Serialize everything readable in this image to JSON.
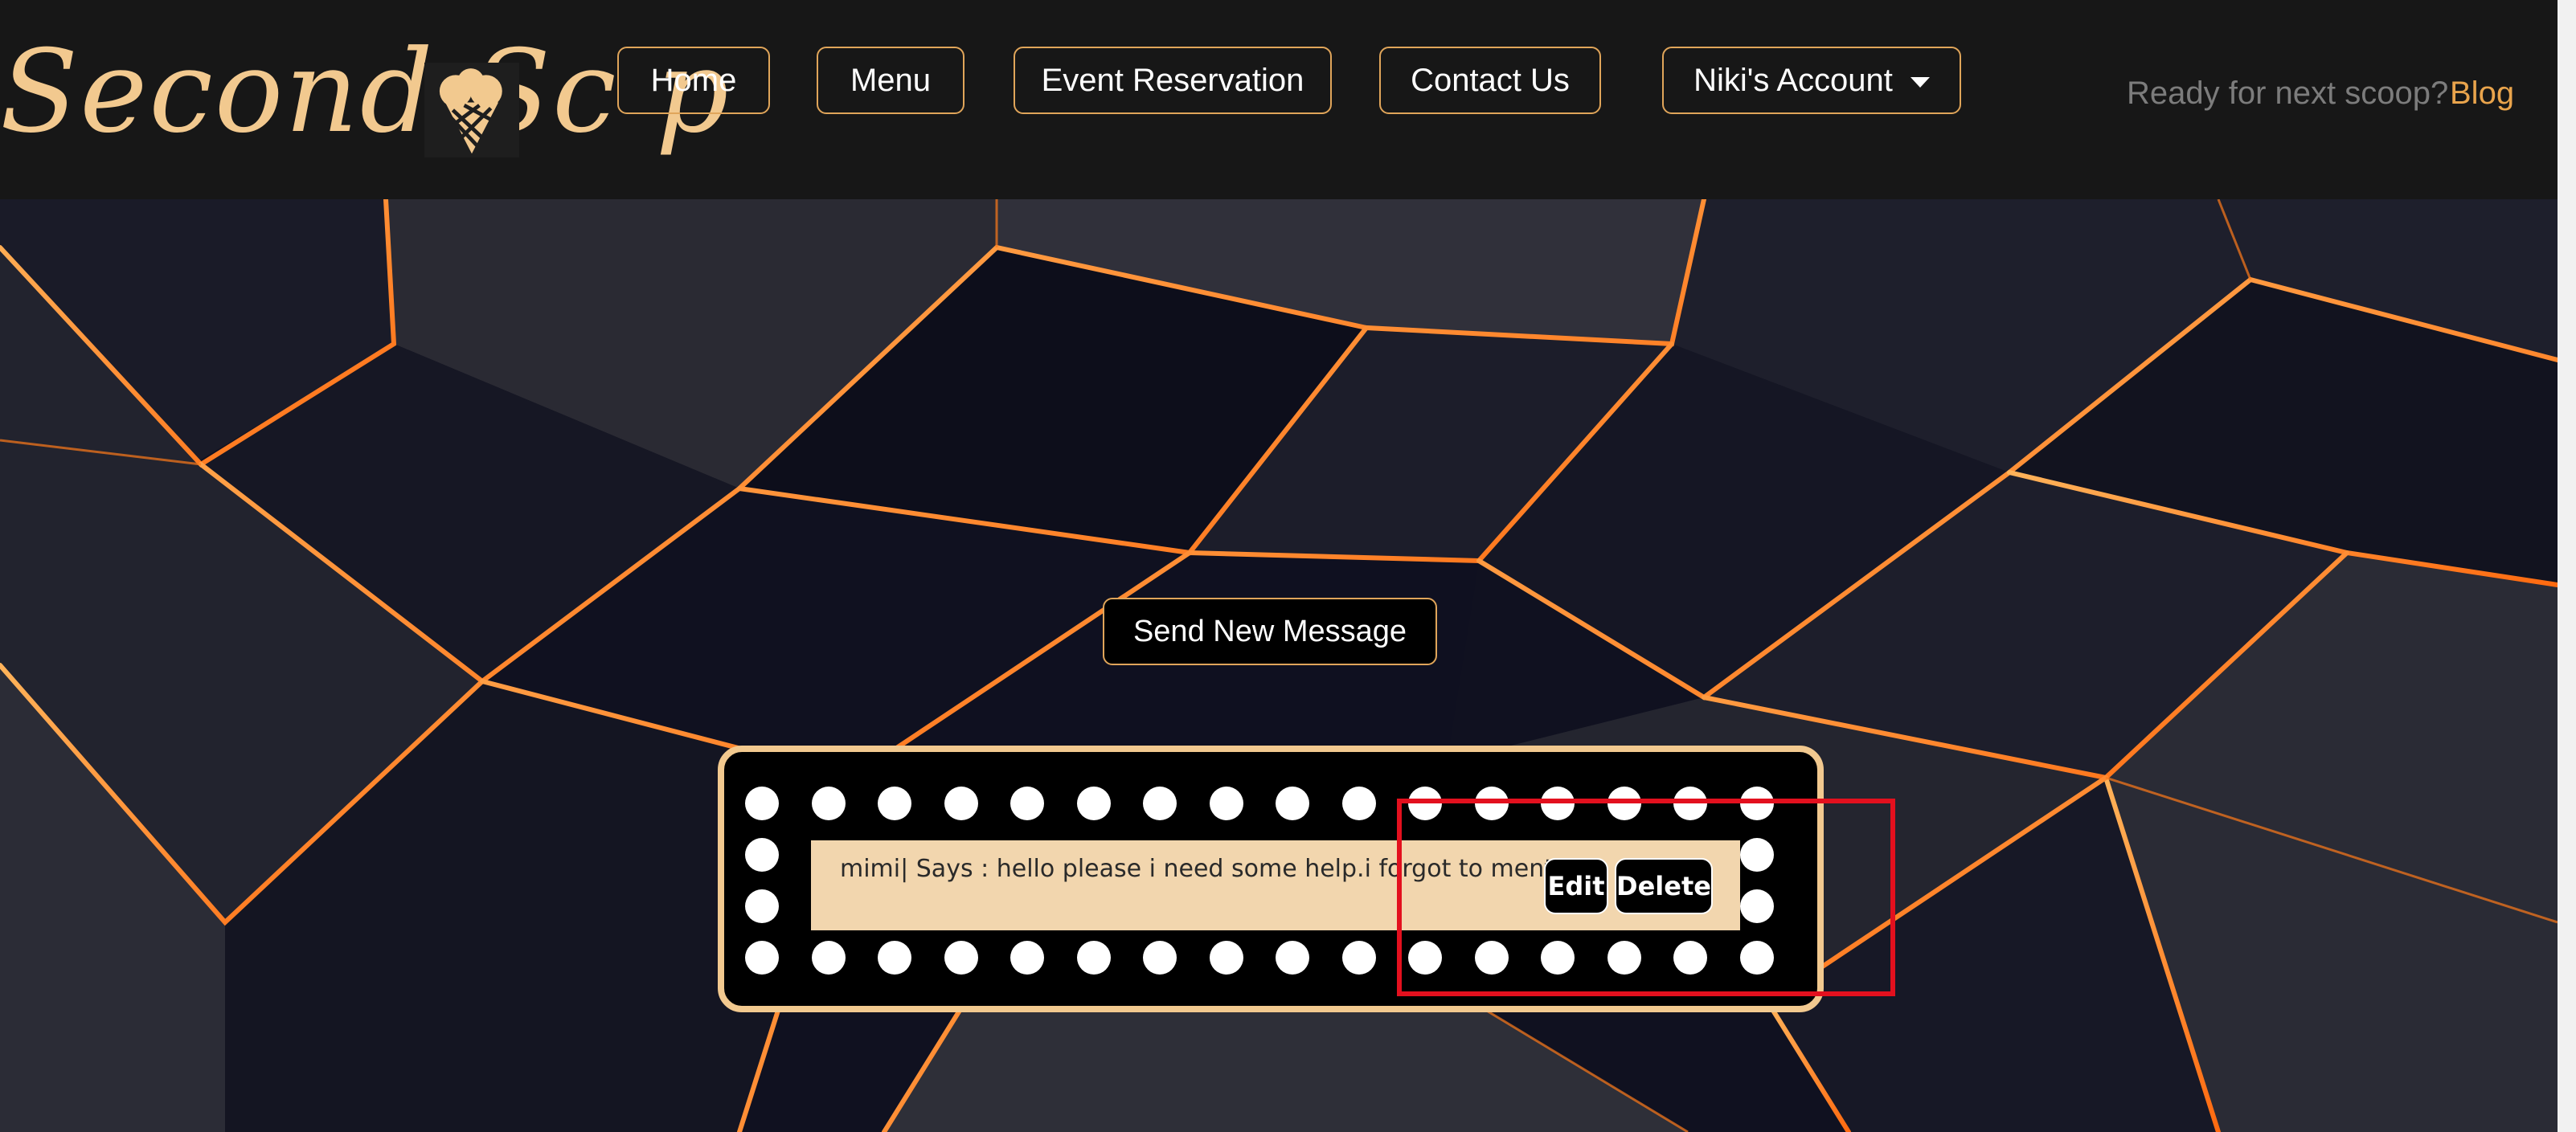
{
  "brand": {
    "logo_text": "Second Sc  p",
    "logo_icon": "ice-cream-cone-icon"
  },
  "nav": {
    "home": "Home",
    "menu": "Menu",
    "event_reservation": "Event Reservation",
    "contact_us": "Contact Us",
    "account": "Niki's Account",
    "tagline": "Ready for next scoop?",
    "blog": "Blog"
  },
  "main": {
    "send_new_message": "Send New Message",
    "messages": [
      {
        "text": "mimi| Says : hello please i need some help.i forgot to mention",
        "edit_label": "Edit",
        "delete_label": "Delete"
      }
    ]
  },
  "colors": {
    "accent": "#e0a55a",
    "logo": "#f2c98f",
    "message_bg": "#f2d6ae",
    "highlight": "#e3101e",
    "navbar_bg": "#171717"
  }
}
